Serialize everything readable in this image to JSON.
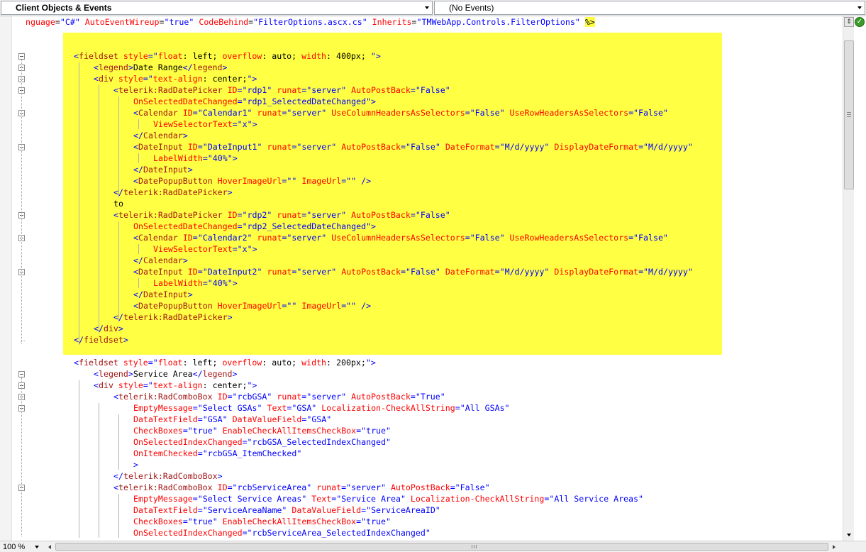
{
  "toolbar": {
    "objects_dropdown": "Client Objects & Events",
    "events_dropdown": "(No Events)"
  },
  "colors": {
    "tag": "#0000ff",
    "element": "#a31515",
    "attribute": "#ff0000",
    "value": "#0000ff",
    "selection_highlight": "#ffff44"
  },
  "code": {
    "lines": [
      [
        [
          "a",
          "nguage"
        ],
        [
          "p",
          "="
        ],
        [
          "v",
          "\"C#\""
        ],
        [
          "p",
          " "
        ],
        [
          "a",
          "AutoEventWireup"
        ],
        [
          "p",
          "="
        ],
        [
          "v",
          "\"true\""
        ],
        [
          "p",
          " "
        ],
        [
          "a",
          "CodeBehind"
        ],
        [
          "p",
          "="
        ],
        [
          "v",
          "\"FilterOptions.ascx.cs\""
        ],
        [
          "p",
          " "
        ],
        [
          "a",
          "Inherits"
        ],
        [
          "p",
          "="
        ],
        [
          "v",
          "\"TMWebApp.Controls.FilterOptions\""
        ],
        [
          "p",
          " "
        ],
        [
          "dir",
          "%>"
        ]
      ],
      [],
      [],
      [
        [
          "t",
          "<"
        ],
        [
          "k",
          "fieldset"
        ],
        [
          "p",
          " "
        ],
        [
          "a",
          "style"
        ],
        [
          "t",
          "=\""
        ],
        [
          "a",
          "float"
        ],
        [
          "p",
          ": left; "
        ],
        [
          "a",
          "overflow"
        ],
        [
          "p",
          ": auto; "
        ],
        [
          "a",
          "width"
        ],
        [
          "p",
          ": 400px; "
        ],
        [
          "t",
          "\">"
        ]
      ],
      [
        [
          "t",
          "<"
        ],
        [
          "k",
          "legend"
        ],
        [
          "t",
          ">"
        ],
        [
          "p",
          "Date Range"
        ],
        [
          "t",
          "</"
        ],
        [
          "k",
          "legend"
        ],
        [
          "t",
          ">"
        ]
      ],
      [
        [
          "t",
          "<"
        ],
        [
          "k",
          "div"
        ],
        [
          "p",
          " "
        ],
        [
          "a",
          "style"
        ],
        [
          "t",
          "=\""
        ],
        [
          "a",
          "text-align"
        ],
        [
          "p",
          ": center;"
        ],
        [
          "t",
          "\">"
        ]
      ],
      [
        [
          "t",
          "<"
        ],
        [
          "k",
          "telerik:RadDatePicker"
        ],
        [
          "p",
          " "
        ],
        [
          "a",
          "ID"
        ],
        [
          "t",
          "=\"rdp1\""
        ],
        [
          "p",
          " "
        ],
        [
          "a",
          "runat"
        ],
        [
          "t",
          "=\"server\""
        ],
        [
          "p",
          " "
        ],
        [
          "a",
          "AutoPostBack"
        ],
        [
          "t",
          "=\"False\""
        ]
      ],
      [
        [
          "a",
          "OnSelectedDateChanged"
        ],
        [
          "t",
          "=\"rdp1_SelectedDateChanged\">"
        ]
      ],
      [
        [
          "t",
          "<"
        ],
        [
          "k",
          "Calendar"
        ],
        [
          "p",
          " "
        ],
        [
          "a",
          "ID"
        ],
        [
          "t",
          "=\"Calendar1\""
        ],
        [
          "p",
          " "
        ],
        [
          "a",
          "runat"
        ],
        [
          "t",
          "=\"server\""
        ],
        [
          "p",
          " "
        ],
        [
          "a",
          "UseColumnHeadersAsSelectors"
        ],
        [
          "t",
          "=\"False\""
        ],
        [
          "p",
          " "
        ],
        [
          "a",
          "UseRowHeadersAsSelectors"
        ],
        [
          "t",
          "=\"False\""
        ]
      ],
      [
        [
          "a",
          "ViewSelectorText"
        ],
        [
          "t",
          "=\"x\">"
        ]
      ],
      [
        [
          "t",
          "</"
        ],
        [
          "k",
          "Calendar"
        ],
        [
          "t",
          ">"
        ]
      ],
      [
        [
          "t",
          "<"
        ],
        [
          "k",
          "DateInput"
        ],
        [
          "p",
          " "
        ],
        [
          "a",
          "ID"
        ],
        [
          "t",
          "=\"DateInput1\""
        ],
        [
          "p",
          " "
        ],
        [
          "a",
          "runat"
        ],
        [
          "t",
          "=\"server\""
        ],
        [
          "p",
          " "
        ],
        [
          "a",
          "AutoPostBack"
        ],
        [
          "t",
          "=\"False\""
        ],
        [
          "p",
          " "
        ],
        [
          "a",
          "DateFormat"
        ],
        [
          "t",
          "=\"M/d/yyyy\""
        ],
        [
          "p",
          " "
        ],
        [
          "a",
          "DisplayDateFormat"
        ],
        [
          "t",
          "=\"M/d/yyyy\""
        ]
      ],
      [
        [
          "a",
          "LabelWidth"
        ],
        [
          "t",
          "=\"40%\">"
        ]
      ],
      [
        [
          "t",
          "</"
        ],
        [
          "k",
          "DateInput"
        ],
        [
          "t",
          ">"
        ]
      ],
      [
        [
          "t",
          "<"
        ],
        [
          "k",
          "DatePopupButton"
        ],
        [
          "p",
          " "
        ],
        [
          "a",
          "HoverImageUrl"
        ],
        [
          "t",
          "=\"\""
        ],
        [
          "p",
          " "
        ],
        [
          "a",
          "ImageUrl"
        ],
        [
          "t",
          "=\"\""
        ],
        [
          "p",
          " "
        ],
        [
          "t",
          "/>"
        ]
      ],
      [
        [
          "t",
          "</"
        ],
        [
          "k",
          "telerik:RadDatePicker"
        ],
        [
          "t",
          ">"
        ]
      ],
      [
        [
          "p",
          "to"
        ]
      ],
      [
        [
          "t",
          "<"
        ],
        [
          "k",
          "telerik:RadDatePicker"
        ],
        [
          "p",
          " "
        ],
        [
          "a",
          "ID"
        ],
        [
          "t",
          "=\"rdp2\""
        ],
        [
          "p",
          " "
        ],
        [
          "a",
          "runat"
        ],
        [
          "t",
          "=\"server\""
        ],
        [
          "p",
          " "
        ],
        [
          "a",
          "AutoPostBack"
        ],
        [
          "t",
          "=\"False\""
        ]
      ],
      [
        [
          "a",
          "OnSelectedDateChanged"
        ],
        [
          "t",
          "=\"rdp2_SelectedDateChanged\">"
        ]
      ],
      [
        [
          "t",
          "<"
        ],
        [
          "k",
          "Calendar"
        ],
        [
          "p",
          " "
        ],
        [
          "a",
          "ID"
        ],
        [
          "t",
          "=\"Calendar2\""
        ],
        [
          "p",
          " "
        ],
        [
          "a",
          "runat"
        ],
        [
          "t",
          "=\"server\""
        ],
        [
          "p",
          " "
        ],
        [
          "a",
          "UseColumnHeadersAsSelectors"
        ],
        [
          "t",
          "=\"False\""
        ],
        [
          "p",
          " "
        ],
        [
          "a",
          "UseRowHeadersAsSelectors"
        ],
        [
          "t",
          "=\"False\""
        ]
      ],
      [
        [
          "a",
          "ViewSelectorText"
        ],
        [
          "t",
          "=\"x\">"
        ]
      ],
      [
        [
          "t",
          "</"
        ],
        [
          "k",
          "Calendar"
        ],
        [
          "t",
          ">"
        ]
      ],
      [
        [
          "t",
          "<"
        ],
        [
          "k",
          "DateInput"
        ],
        [
          "p",
          " "
        ],
        [
          "a",
          "ID"
        ],
        [
          "t",
          "=\"DateInput2\""
        ],
        [
          "p",
          " "
        ],
        [
          "a",
          "runat"
        ],
        [
          "t",
          "=\"server\""
        ],
        [
          "p",
          " "
        ],
        [
          "a",
          "AutoPostBack"
        ],
        [
          "t",
          "=\"False\""
        ],
        [
          "p",
          " "
        ],
        [
          "a",
          "DateFormat"
        ],
        [
          "t",
          "=\"M/d/yyyy\""
        ],
        [
          "p",
          " "
        ],
        [
          "a",
          "DisplayDateFormat"
        ],
        [
          "t",
          "=\"M/d/yyyy\""
        ]
      ],
      [
        [
          "a",
          "LabelWidth"
        ],
        [
          "t",
          "=\"40%\">"
        ]
      ],
      [
        [
          "t",
          "</"
        ],
        [
          "k",
          "DateInput"
        ],
        [
          "t",
          ">"
        ]
      ],
      [
        [
          "t",
          "<"
        ],
        [
          "k",
          "DatePopupButton"
        ],
        [
          "p",
          " "
        ],
        [
          "a",
          "HoverImageUrl"
        ],
        [
          "t",
          "=\"\""
        ],
        [
          "p",
          " "
        ],
        [
          "a",
          "ImageUrl"
        ],
        [
          "t",
          "=\"\""
        ],
        [
          "p",
          " "
        ],
        [
          "t",
          "/>"
        ]
      ],
      [
        [
          "t",
          "</"
        ],
        [
          "k",
          "telerik:RadDatePicker"
        ],
        [
          "t",
          ">"
        ]
      ],
      [
        [
          "t",
          "</"
        ],
        [
          "k",
          "div"
        ],
        [
          "t",
          ">"
        ]
      ],
      [
        [
          "t",
          "</"
        ],
        [
          "k",
          "fieldset"
        ],
        [
          "t",
          ">"
        ]
      ],
      [],
      [
        [
          "t",
          "<"
        ],
        [
          "k",
          "fieldset"
        ],
        [
          "p",
          " "
        ],
        [
          "a",
          "style"
        ],
        [
          "t",
          "=\""
        ],
        [
          "a",
          "float"
        ],
        [
          "p",
          ": left; "
        ],
        [
          "a",
          "overflow"
        ],
        [
          "p",
          ": auto; "
        ],
        [
          "a",
          "width"
        ],
        [
          "p",
          ": 200px;"
        ],
        [
          "t",
          "\">"
        ]
      ],
      [
        [
          "t",
          "<"
        ],
        [
          "k",
          "legend"
        ],
        [
          "t",
          ">"
        ],
        [
          "p",
          "Service Area"
        ],
        [
          "t",
          "</"
        ],
        [
          "k",
          "legend"
        ],
        [
          "t",
          ">"
        ]
      ],
      [
        [
          "t",
          "<"
        ],
        [
          "k",
          "div"
        ],
        [
          "p",
          " "
        ],
        [
          "a",
          "style"
        ],
        [
          "t",
          "=\""
        ],
        [
          "a",
          "text-align"
        ],
        [
          "p",
          ": center;"
        ],
        [
          "t",
          "\">"
        ]
      ],
      [
        [
          "t",
          "<"
        ],
        [
          "k",
          "telerik:RadComboBox"
        ],
        [
          "p",
          " "
        ],
        [
          "a",
          "ID"
        ],
        [
          "t",
          "=\"rcbGSA\""
        ],
        [
          "p",
          " "
        ],
        [
          "a",
          "runat"
        ],
        [
          "t",
          "=\"server\""
        ],
        [
          "p",
          " "
        ],
        [
          "a",
          "AutoPostBack"
        ],
        [
          "t",
          "=\"True\""
        ]
      ],
      [
        [
          "a",
          "EmptyMessage"
        ],
        [
          "t",
          "=\"Select GSAs\""
        ],
        [
          "p",
          " "
        ],
        [
          "a",
          "Text"
        ],
        [
          "t",
          "=\"GSA\""
        ],
        [
          "p",
          " "
        ],
        [
          "a",
          "Localization-CheckAllString"
        ],
        [
          "t",
          "=\"All GSAs\""
        ]
      ],
      [
        [
          "a",
          "DataTextField"
        ],
        [
          "t",
          "=\"GSA\""
        ],
        [
          "p",
          " "
        ],
        [
          "a",
          "DataValueField"
        ],
        [
          "t",
          "=\"GSA\""
        ]
      ],
      [
        [
          "a",
          "CheckBoxes"
        ],
        [
          "t",
          "=\"true\""
        ],
        [
          "p",
          " "
        ],
        [
          "a",
          "EnableCheckAllItemsCheckBox"
        ],
        [
          "t",
          "=\"true\""
        ]
      ],
      [
        [
          "a",
          "OnSelectedIndexChanged"
        ],
        [
          "t",
          "=\"rcbGSA_SelectedIndexChanged\""
        ]
      ],
      [
        [
          "a",
          "OnItemChecked"
        ],
        [
          "t",
          "=\"rcbGSA_ItemChecked\""
        ]
      ],
      [
        [
          "t",
          ">"
        ]
      ],
      [
        [
          "t",
          "</"
        ],
        [
          "k",
          "telerik:RadComboBox"
        ],
        [
          "t",
          ">"
        ]
      ],
      [
        [
          "t",
          "<"
        ],
        [
          "k",
          "telerik:RadComboBox"
        ],
        [
          "p",
          " "
        ],
        [
          "a",
          "ID"
        ],
        [
          "t",
          "=\"rcbServiceArea\""
        ],
        [
          "p",
          " "
        ],
        [
          "a",
          "runat"
        ],
        [
          "t",
          "=\"server\""
        ],
        [
          "p",
          " "
        ],
        [
          "a",
          "AutoPostBack"
        ],
        [
          "t",
          "=\"False\""
        ]
      ],
      [
        [
          "a",
          "EmptyMessage"
        ],
        [
          "t",
          "=\"Select Service Areas\""
        ],
        [
          "p",
          " "
        ],
        [
          "a",
          "Text"
        ],
        [
          "t",
          "=\"Service Area\""
        ],
        [
          "p",
          " "
        ],
        [
          "a",
          "Localization-CheckAllString"
        ],
        [
          "t",
          "=\"All Service Areas\""
        ]
      ],
      [
        [
          "a",
          "DataTextField"
        ],
        [
          "t",
          "=\"ServiceAreaName\""
        ],
        [
          "p",
          " "
        ],
        [
          "a",
          "DataValueField"
        ],
        [
          "t",
          "=\"ServiceAreaID\""
        ]
      ],
      [
        [
          "a",
          "CheckBoxes"
        ],
        [
          "t",
          "=\"true\""
        ],
        [
          "p",
          " "
        ],
        [
          "a",
          "EnableCheckAllItemsCheckBox"
        ],
        [
          "t",
          "=\"true\""
        ]
      ],
      [
        [
          "a",
          "OnSelectedIndexChanged"
        ],
        [
          "t",
          "=\"rcbServiceArea_SelectedIndexChanged\""
        ]
      ]
    ]
  },
  "statusbar": {
    "zoom_level": "100 %"
  },
  "icons": {
    "split_handle": "split-icon",
    "status": "checkmark-icon"
  },
  "ok_glyph": "✓",
  "split_glyph": "⇕"
}
